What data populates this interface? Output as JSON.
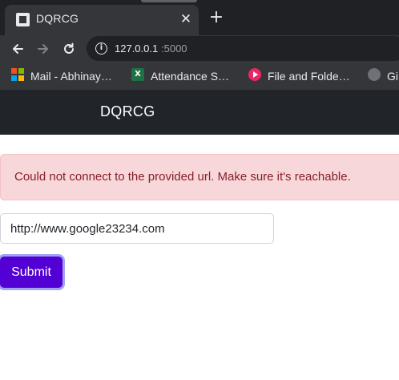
{
  "browser": {
    "tab": {
      "title": "DQRCG",
      "close_icon": "close-icon"
    },
    "new_tab_label": "+",
    "address_bar": {
      "host": "127.0.0.1",
      "port": ":5000"
    },
    "bookmarks": [
      {
        "label": "Mail - Abhinay…",
        "icon": "microsoft-icon"
      },
      {
        "label": "Attendance S…",
        "icon": "excel-icon"
      },
      {
        "label": "File and Folde…",
        "icon": "play-icon"
      },
      {
        "label": "Gi",
        "icon": "github-icon"
      }
    ]
  },
  "page": {
    "brand": "DQRCG",
    "alert_message": "Could not connect to the provided url. Make sure it's reachable.",
    "url_input_value": "http://www.google23234.com",
    "submit_label": "Submit"
  },
  "colors": {
    "navbar": "#212529",
    "alert_bg": "#f8d7da",
    "alert_text": "#842029",
    "submit_bg": "#5200d3",
    "submit_focus_ring": "#a2a0f7"
  }
}
